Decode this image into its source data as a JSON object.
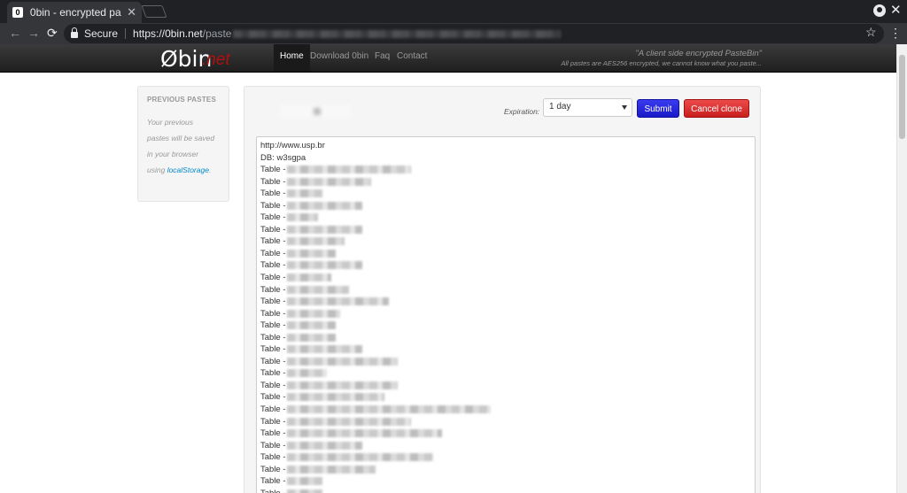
{
  "browser": {
    "tab_title": "0bin - encrypted pas",
    "tab_favicon": "0",
    "secure_label": "Secure",
    "url_prefix": "https://",
    "url_host": "0bin.net",
    "url_path": "/paste"
  },
  "site": {
    "brand": "Øbin",
    "brand_tld": ".net",
    "nav": [
      "Home",
      "Download 0bin",
      "Faq",
      "Contact"
    ],
    "tagline": "\"A client side encrypted PasteBin\"",
    "tagline_sub": "All pastes are AES256 encrypted, we cannot know what you paste..."
  },
  "sidebar": {
    "title": "PREVIOUS PASTES",
    "text_lines": [
      "Your previous",
      "pastes will be saved",
      "in your browser"
    ],
    "text_using": "using ",
    "link": "localStorage",
    "text_end": "."
  },
  "form": {
    "expiration_label": "Expiration:",
    "expiration_value": "1 day",
    "submit_label": "Submit",
    "cancel_label": "Cancel clone"
  },
  "paste": {
    "line1": "http://www.usp.br",
    "line2": "DB: w3sgpa",
    "table_prefix": "Table -",
    "rows": 29
  },
  "colors": {
    "brand_tld": "#b01010",
    "submit": "#2323dd",
    "cancel": "#dd3333",
    "link": "#0088cc"
  }
}
